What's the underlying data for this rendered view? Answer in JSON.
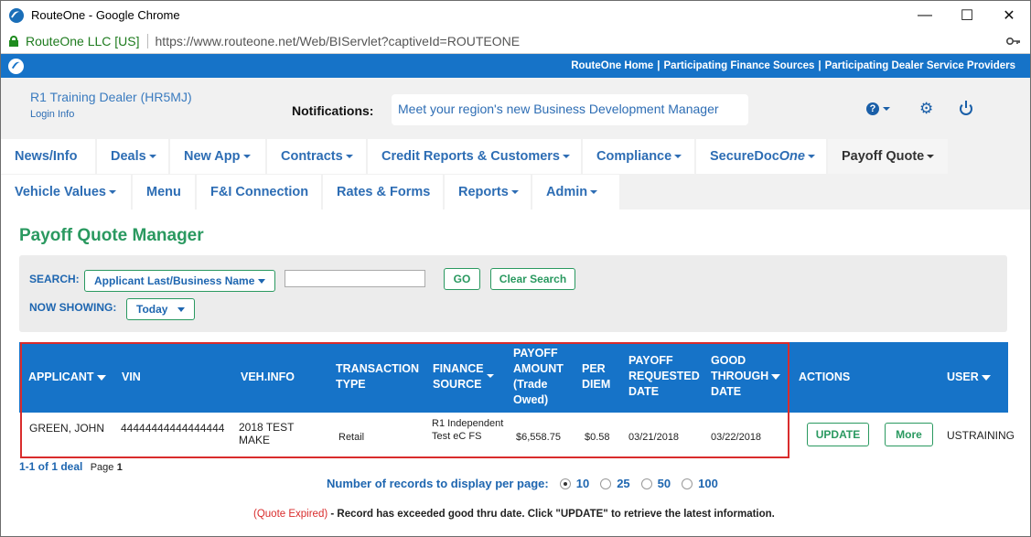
{
  "browser": {
    "window_title": "RouteOne - Google Chrome",
    "controls": {
      "minimize": "—",
      "maximize": "☐",
      "close": "✕"
    },
    "secure_label": "RouteOne LLC [US]",
    "url": "https://www.routeone.net/Web/BIServlet?captiveId=ROUTEONE"
  },
  "topbar": {
    "links": [
      "RouteOne Home",
      "Participating Finance Sources",
      "Participating Dealer Service Providers"
    ],
    "separator": "|"
  },
  "header": {
    "dealer_name": "R1 Training Dealer (HR5MJ)",
    "login_info": "Login Info",
    "notifications_label": "Notifications:",
    "notification_text": "Meet your region's new Business Development Manager",
    "help_glyph": "?",
    "gear_glyph": "⚙"
  },
  "nav": {
    "row1": [
      {
        "label": "News/Info",
        "dropdown": false
      },
      {
        "label": "Deals",
        "dropdown": true
      },
      {
        "label": "New App",
        "dropdown": true
      },
      {
        "label": "Contracts",
        "dropdown": true
      },
      {
        "label": "Credit Reports & Customers",
        "dropdown": true
      },
      {
        "label": "Compliance",
        "dropdown": true
      },
      {
        "label_main": "SecureDoc",
        "label_em": "One",
        "dropdown": true
      },
      {
        "label": "Payoff Quote",
        "dropdown": true,
        "active": true
      }
    ],
    "row2": [
      {
        "label": "Vehicle Values",
        "dropdown": true
      },
      {
        "label": "Menu",
        "dropdown": false
      },
      {
        "label": "F&I Connection",
        "dropdown": false
      },
      {
        "label": "Rates & Forms",
        "dropdown": false
      },
      {
        "label": "Reports",
        "dropdown": true
      },
      {
        "label": "Admin",
        "dropdown": true
      }
    ]
  },
  "page": {
    "title": "Payoff Quote Manager",
    "search_label": "SEARCH:",
    "search_by": "Applicant Last/Business Name",
    "search_value": "",
    "go_label": "GO",
    "clear_label": "Clear Search",
    "showing_label": "NOW SHOWING:",
    "showing_value": "Today"
  },
  "table": {
    "columns": {
      "applicant": "APPLICANT",
      "vin": "VIN",
      "veh_info": "VEH.INFO",
      "transaction_type": [
        "TRANSACTION",
        "TYPE"
      ],
      "finance_source": [
        "FINANCE",
        "SOURCE"
      ],
      "payoff_amount": [
        "PAYOFF",
        "AMOUNT",
        "(Trade",
        "Owed)"
      ],
      "per_diem": [
        "PER",
        "DIEM"
      ],
      "payoff_requested_date": [
        "PAYOFF",
        "REQUESTED",
        "DATE"
      ],
      "good_through_date": [
        "GOOD",
        "THROUGH",
        "DATE"
      ],
      "actions": "ACTIONS",
      "user": "USER"
    },
    "rows": [
      {
        "applicant": "GREEN, JOHN",
        "vin": "44444444444444444",
        "veh_info": [
          "2018 TEST",
          "MAKE"
        ],
        "transaction_type": "Retail",
        "finance_source": [
          "R1 Independent",
          "Test eC FS"
        ],
        "payoff_amount": "$6,558.75",
        "per_diem": "$0.58",
        "payoff_requested_date": "03/21/2018",
        "good_through_date": "03/22/2018",
        "update_label": "UPDATE",
        "more_label": "More",
        "user": "USTRAINING"
      }
    ]
  },
  "pager": {
    "summary": "1-1 of 1 deal",
    "page_label": "Page",
    "page_number": "1",
    "records_label": "Number of records to display per page:",
    "options": [
      "10",
      "25",
      "50",
      "100"
    ],
    "selected": "10"
  },
  "footnote": {
    "expired": "(Quote Expired)",
    "text": " - Record has exceeded good thru date. Click \"UPDATE\" to retrieve the latest information."
  },
  "colors": {
    "brand_blue": "#1673c8",
    "accent_green": "#2a9960",
    "highlight_red": "#d92c2c"
  }
}
